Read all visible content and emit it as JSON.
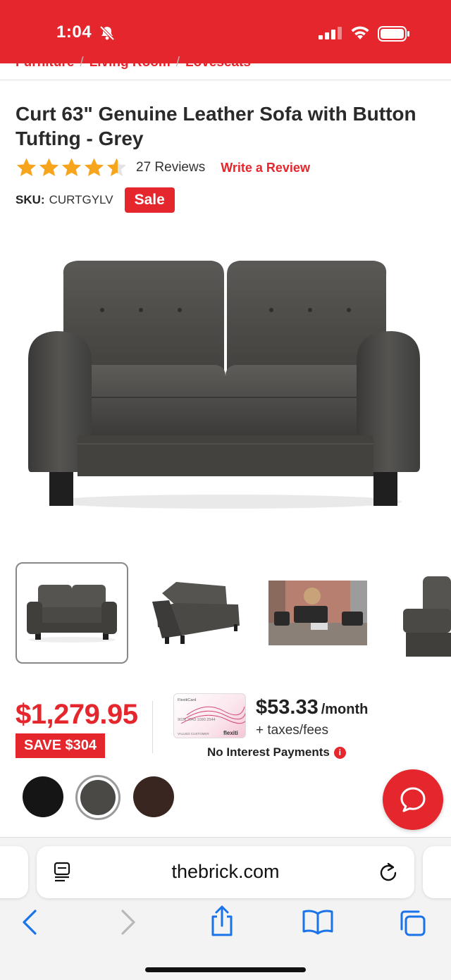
{
  "status": {
    "time": "1:04"
  },
  "breadcrumb": [
    "Furniture",
    "Living Room",
    "Loveseats"
  ],
  "product": {
    "title": "Curt 63\" Genuine Leather Sofa with Button Tufting - Grey",
    "rating": 4.5,
    "reviews": "27 Reviews",
    "write_review": "Write a Review",
    "sku_label": "SKU:",
    "sku_value": "CURTGYLV",
    "sale_badge": "Sale"
  },
  "gallery": {
    "thumbnails": [
      "loveseat-front",
      "loveseat-angle",
      "room-scene",
      "loveseat-side"
    ],
    "active_index": 0
  },
  "pricing": {
    "price": "$1,279.95",
    "save": "SAVE $304",
    "monthly_amount": "$53.33",
    "monthly_unit": "/month",
    "taxes": "+ taxes/fees",
    "no_interest": "No Interest Payments"
  },
  "flexiti_card": {
    "brand": "FlexitiCard",
    "number": "9026 2543 1090 2544",
    "holder": "VALUED CUSTOMER",
    "logo": "flexiti"
  },
  "swatches": [
    {
      "name": "Black",
      "color": "#151515"
    },
    {
      "name": "Grey",
      "color": "#4a4946"
    },
    {
      "name": "Brown",
      "color": "#3a2620"
    }
  ],
  "selected_swatch": 1,
  "colors": {
    "accent": "#e5262d",
    "leather": "#4a4946"
  },
  "browser": {
    "url": "thebrick.com"
  }
}
